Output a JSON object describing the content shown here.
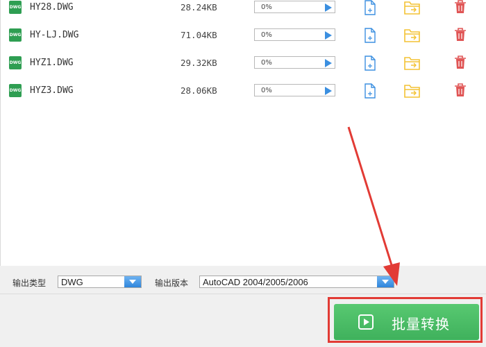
{
  "files": [
    {
      "icon_label": "DWG",
      "name": "HY28.DWG",
      "size": "28.24KB",
      "progress": "0%"
    },
    {
      "icon_label": "DWG",
      "name": "HY-LJ.DWG",
      "size": "71.04KB",
      "progress": "0%"
    },
    {
      "icon_label": "DWG",
      "name": "HYZ1.DWG",
      "size": "29.32KB",
      "progress": "0%"
    },
    {
      "icon_label": "DWG",
      "name": "HYZ3.DWG",
      "size": "28.06KB",
      "progress": "0%"
    }
  ],
  "icons": {
    "file_type": "dwg-file-icon",
    "preview": "document-preview-icon",
    "open_folder": "folder-open-icon",
    "delete": "trash-icon",
    "play": "play-icon"
  },
  "options": {
    "output_type_label": "输出类型",
    "output_type_value": "DWG",
    "output_version_label": "输出版本",
    "output_version_value": "AutoCAD 2004/2005/2006"
  },
  "convert_button": {
    "label": "批量转换"
  },
  "colors": {
    "accent_blue": "#3b8fe0",
    "folder_yellow": "#f3c233",
    "delete_red": "#e05555",
    "button_green": "#4cbc66",
    "annotation_red": "#e23b35"
  }
}
